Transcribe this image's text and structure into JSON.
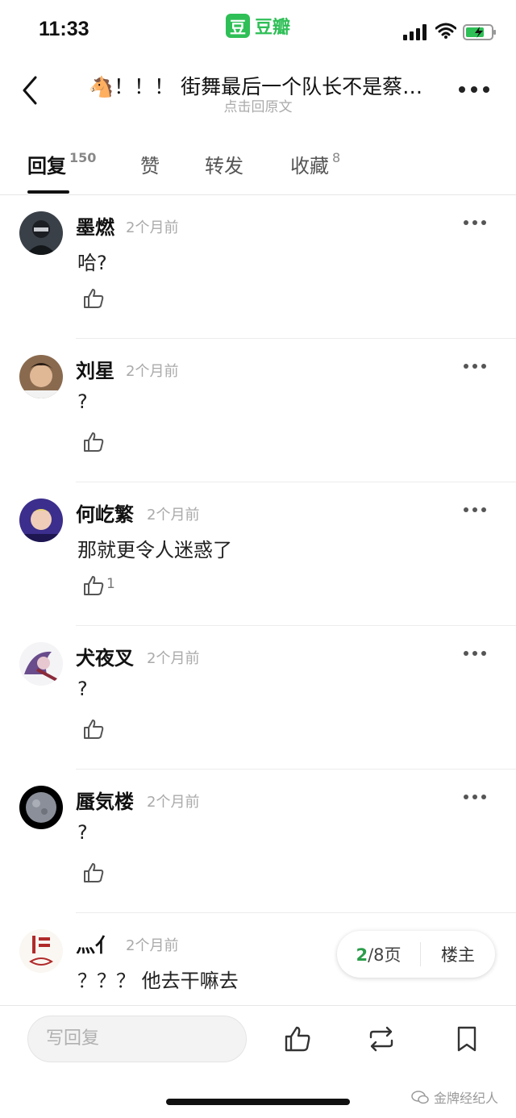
{
  "status_bar": {
    "time": "11:33",
    "app_logo": "豆",
    "app_name": "豆瓣"
  },
  "header": {
    "title": "🐴！！！ 街舞最后一个队长不是蔡…",
    "subtitle": "点击回原文"
  },
  "tabs": [
    {
      "label": "回复",
      "count": "150"
    },
    {
      "label": "赞",
      "count": ""
    },
    {
      "label": "转发",
      "count": ""
    },
    {
      "label": "收藏",
      "count": "8"
    }
  ],
  "comments": [
    {
      "name": "墨燃",
      "ago": "2个月前",
      "text": "哈?",
      "likes": ""
    },
    {
      "name": "刘星",
      "ago": "2个月前",
      "text": "?",
      "likes": ""
    },
    {
      "name": "何屹繁",
      "ago": "2个月前",
      "text": "那就更令人迷惑了",
      "likes": "1"
    },
    {
      "name": "犬夜叉",
      "ago": "2个月前",
      "text": "?",
      "likes": ""
    },
    {
      "name": "蜃気楼",
      "ago": "2个月前",
      "text": "?",
      "likes": ""
    },
    {
      "name": "灬亻",
      "ago": "2个月前",
      "text": "？？？ 他去干嘛去",
      "likes": ""
    }
  ],
  "pager": {
    "current": "2",
    "total": "/8页",
    "host_label": "楼主"
  },
  "bottom": {
    "reply_placeholder": "写回复"
  },
  "watermark": "金牌经纪人",
  "colors": {
    "accent_green": "#2fbf57",
    "page_green": "#2a9d4a"
  }
}
